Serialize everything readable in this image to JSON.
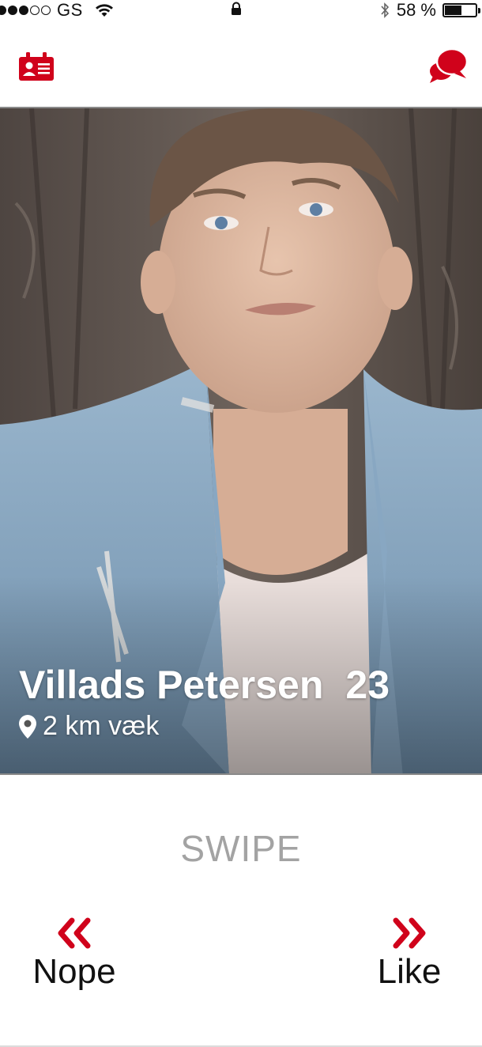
{
  "status_bar": {
    "carrier": "GS",
    "signal_dots_filled": 3,
    "signal_dots_total": 5,
    "battery_percent_label": "58 %",
    "battery_level": 0.58
  },
  "nav": {
    "left_icon": "profile-card-icon",
    "right_icon": "chat-bubbles-icon"
  },
  "profile": {
    "name": "Villads Petersen",
    "age": "23",
    "distance": "2 km væk"
  },
  "swipe_label": "SWIPE",
  "actions": {
    "nope_label": "Nope",
    "like_label": "Like"
  },
  "colors": {
    "accent": "#d0021b",
    "muted_text": "#a3a3a3"
  }
}
